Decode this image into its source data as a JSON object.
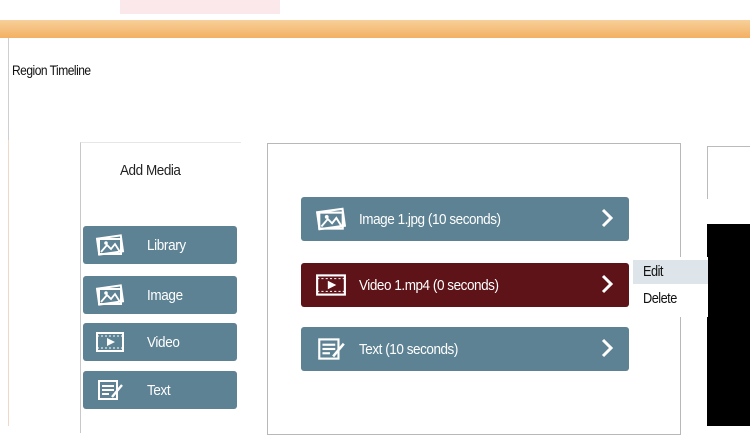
{
  "window": {
    "title": "Region Timeline"
  },
  "add_media": {
    "title": "Add Media",
    "buttons": [
      {
        "label": "Library",
        "icon": "image-icon"
      },
      {
        "label": "Image",
        "icon": "image-icon"
      },
      {
        "label": "Video",
        "icon": "video-icon"
      },
      {
        "label": "Text",
        "icon": "text-edit-icon"
      }
    ]
  },
  "timeline": {
    "items": [
      {
        "label": "Image 1.jpg (10 seconds)",
        "icon": "image-icon",
        "selected": false
      },
      {
        "label": "Video 1.mp4 (0 seconds)",
        "icon": "video-icon",
        "selected": true
      },
      {
        "label": "Text (10 seconds)",
        "icon": "text-edit-icon",
        "selected": false
      }
    ]
  },
  "context_menu": {
    "items": [
      {
        "label": "Edit",
        "hovered": true
      },
      {
        "label": "Delete",
        "hovered": false
      }
    ]
  },
  "colors": {
    "button": "#5d8294",
    "selected_item": "#5e1318",
    "titlebar": "#f3b062"
  }
}
